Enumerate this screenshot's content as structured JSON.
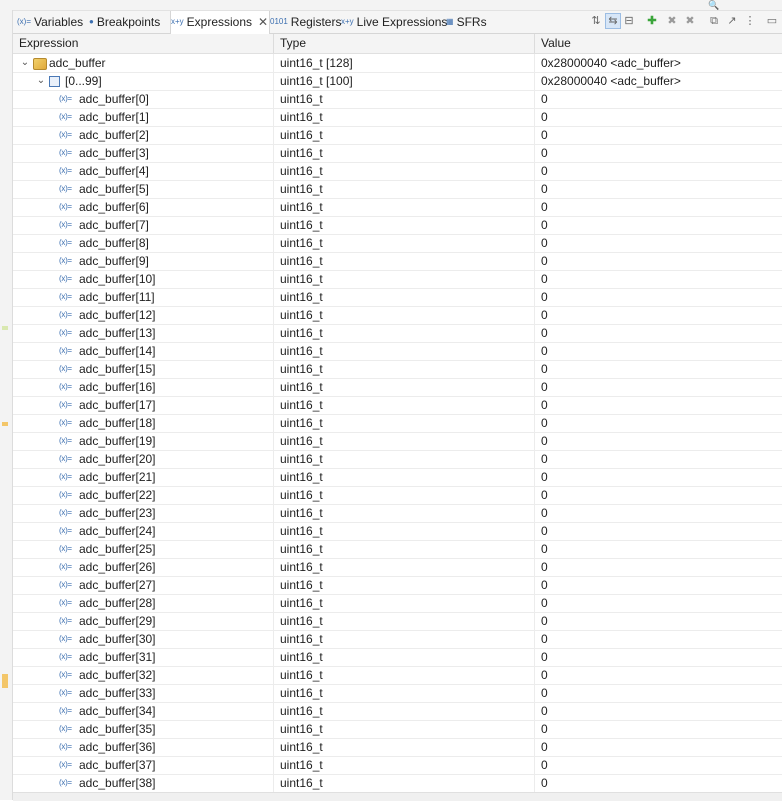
{
  "tabs": [
    {
      "label": "Variables",
      "icon": "variables-icon",
      "icon_glyph": "(x)="
    },
    {
      "label": "Breakpoints",
      "icon": "breakpoints-icon",
      "icon_glyph": "●"
    },
    {
      "label": "Expressions",
      "icon": "expressions-icon",
      "icon_glyph": "x+y",
      "active": true
    },
    {
      "label": "Registers",
      "icon": "registers-icon",
      "icon_glyph": "0101"
    },
    {
      "label": "Live Expressions",
      "icon": "live-expressions-icon",
      "icon_glyph": "x+y"
    },
    {
      "label": "SFRs",
      "icon": "sfrs-icon",
      "icon_glyph": "▦"
    }
  ],
  "columns": {
    "expression": "Expression",
    "type": "Type",
    "value": "Value"
  },
  "tree": {
    "root": {
      "name": "adc_buffer",
      "type": "uint16_t [128]",
      "value": "0x28000040 <adc_buffer>",
      "expanded": true
    },
    "group": {
      "name": "[0...99]",
      "type": "uint16_t [100]",
      "value": "0x28000040 <adc_buffer>",
      "expanded": true
    },
    "element_type": "uint16_t",
    "elements": [
      {
        "name": "adc_buffer[0]",
        "value": "0"
      },
      {
        "name": "adc_buffer[1]",
        "value": "0"
      },
      {
        "name": "adc_buffer[2]",
        "value": "0"
      },
      {
        "name": "adc_buffer[3]",
        "value": "0"
      },
      {
        "name": "adc_buffer[4]",
        "value": "0"
      },
      {
        "name": "adc_buffer[5]",
        "value": "0"
      },
      {
        "name": "adc_buffer[6]",
        "value": "0"
      },
      {
        "name": "adc_buffer[7]",
        "value": "0"
      },
      {
        "name": "adc_buffer[8]",
        "value": "0"
      },
      {
        "name": "adc_buffer[9]",
        "value": "0"
      },
      {
        "name": "adc_buffer[10]",
        "value": "0"
      },
      {
        "name": "adc_buffer[11]",
        "value": "0"
      },
      {
        "name": "adc_buffer[12]",
        "value": "0"
      },
      {
        "name": "adc_buffer[13]",
        "value": "0"
      },
      {
        "name": "adc_buffer[14]",
        "value": "0"
      },
      {
        "name": "adc_buffer[15]",
        "value": "0"
      },
      {
        "name": "adc_buffer[16]",
        "value": "0"
      },
      {
        "name": "adc_buffer[17]",
        "value": "0"
      },
      {
        "name": "adc_buffer[18]",
        "value": "0"
      },
      {
        "name": "adc_buffer[19]",
        "value": "0"
      },
      {
        "name": "adc_buffer[20]",
        "value": "0"
      },
      {
        "name": "adc_buffer[21]",
        "value": "0"
      },
      {
        "name": "adc_buffer[22]",
        "value": "0"
      },
      {
        "name": "adc_buffer[23]",
        "value": "0"
      },
      {
        "name": "adc_buffer[24]",
        "value": "0"
      },
      {
        "name": "adc_buffer[25]",
        "value": "0"
      },
      {
        "name": "adc_buffer[26]",
        "value": "0"
      },
      {
        "name": "adc_buffer[27]",
        "value": "0"
      },
      {
        "name": "adc_buffer[28]",
        "value": "0"
      },
      {
        "name": "adc_buffer[29]",
        "value": "0"
      },
      {
        "name": "adc_buffer[30]",
        "value": "0"
      },
      {
        "name": "adc_buffer[31]",
        "value": "0"
      },
      {
        "name": "adc_buffer[32]",
        "value": "0"
      },
      {
        "name": "adc_buffer[33]",
        "value": "0"
      },
      {
        "name": "adc_buffer[34]",
        "value": "0"
      },
      {
        "name": "adc_buffer[35]",
        "value": "0"
      },
      {
        "name": "adc_buffer[36]",
        "value": "0"
      },
      {
        "name": "adc_buffer[37]",
        "value": "0"
      },
      {
        "name": "adc_buffer[38]",
        "value": "0"
      }
    ]
  },
  "toolbar": {
    "buttons": [
      {
        "name": "show-type-names-button",
        "glyph": "⇅"
      },
      {
        "name": "show-logical-structure-button",
        "glyph": "⇆",
        "pressed": true
      },
      {
        "name": "collapse-all-button",
        "glyph": "⊟"
      },
      {
        "name": "add-expression-button",
        "glyph": "✚",
        "style": "green"
      },
      {
        "name": "remove-expression-button",
        "glyph": "✖",
        "style": "gray"
      },
      {
        "name": "remove-all-expressions-button",
        "glyph": "✖",
        "style": "gray"
      },
      {
        "name": "new-view-button",
        "glyph": "⧉"
      },
      {
        "name": "pin-view-button",
        "glyph": "↗"
      },
      {
        "name": "view-menu-button",
        "glyph": "⋮"
      },
      {
        "name": "minimize-button",
        "glyph": "▭"
      }
    ]
  },
  "colors": {
    "accent": "#3c6fb0",
    "tab_bg": "#f5f5f5",
    "active_tab_bg": "#ffffff",
    "header_bg": "#f4f4f4"
  }
}
